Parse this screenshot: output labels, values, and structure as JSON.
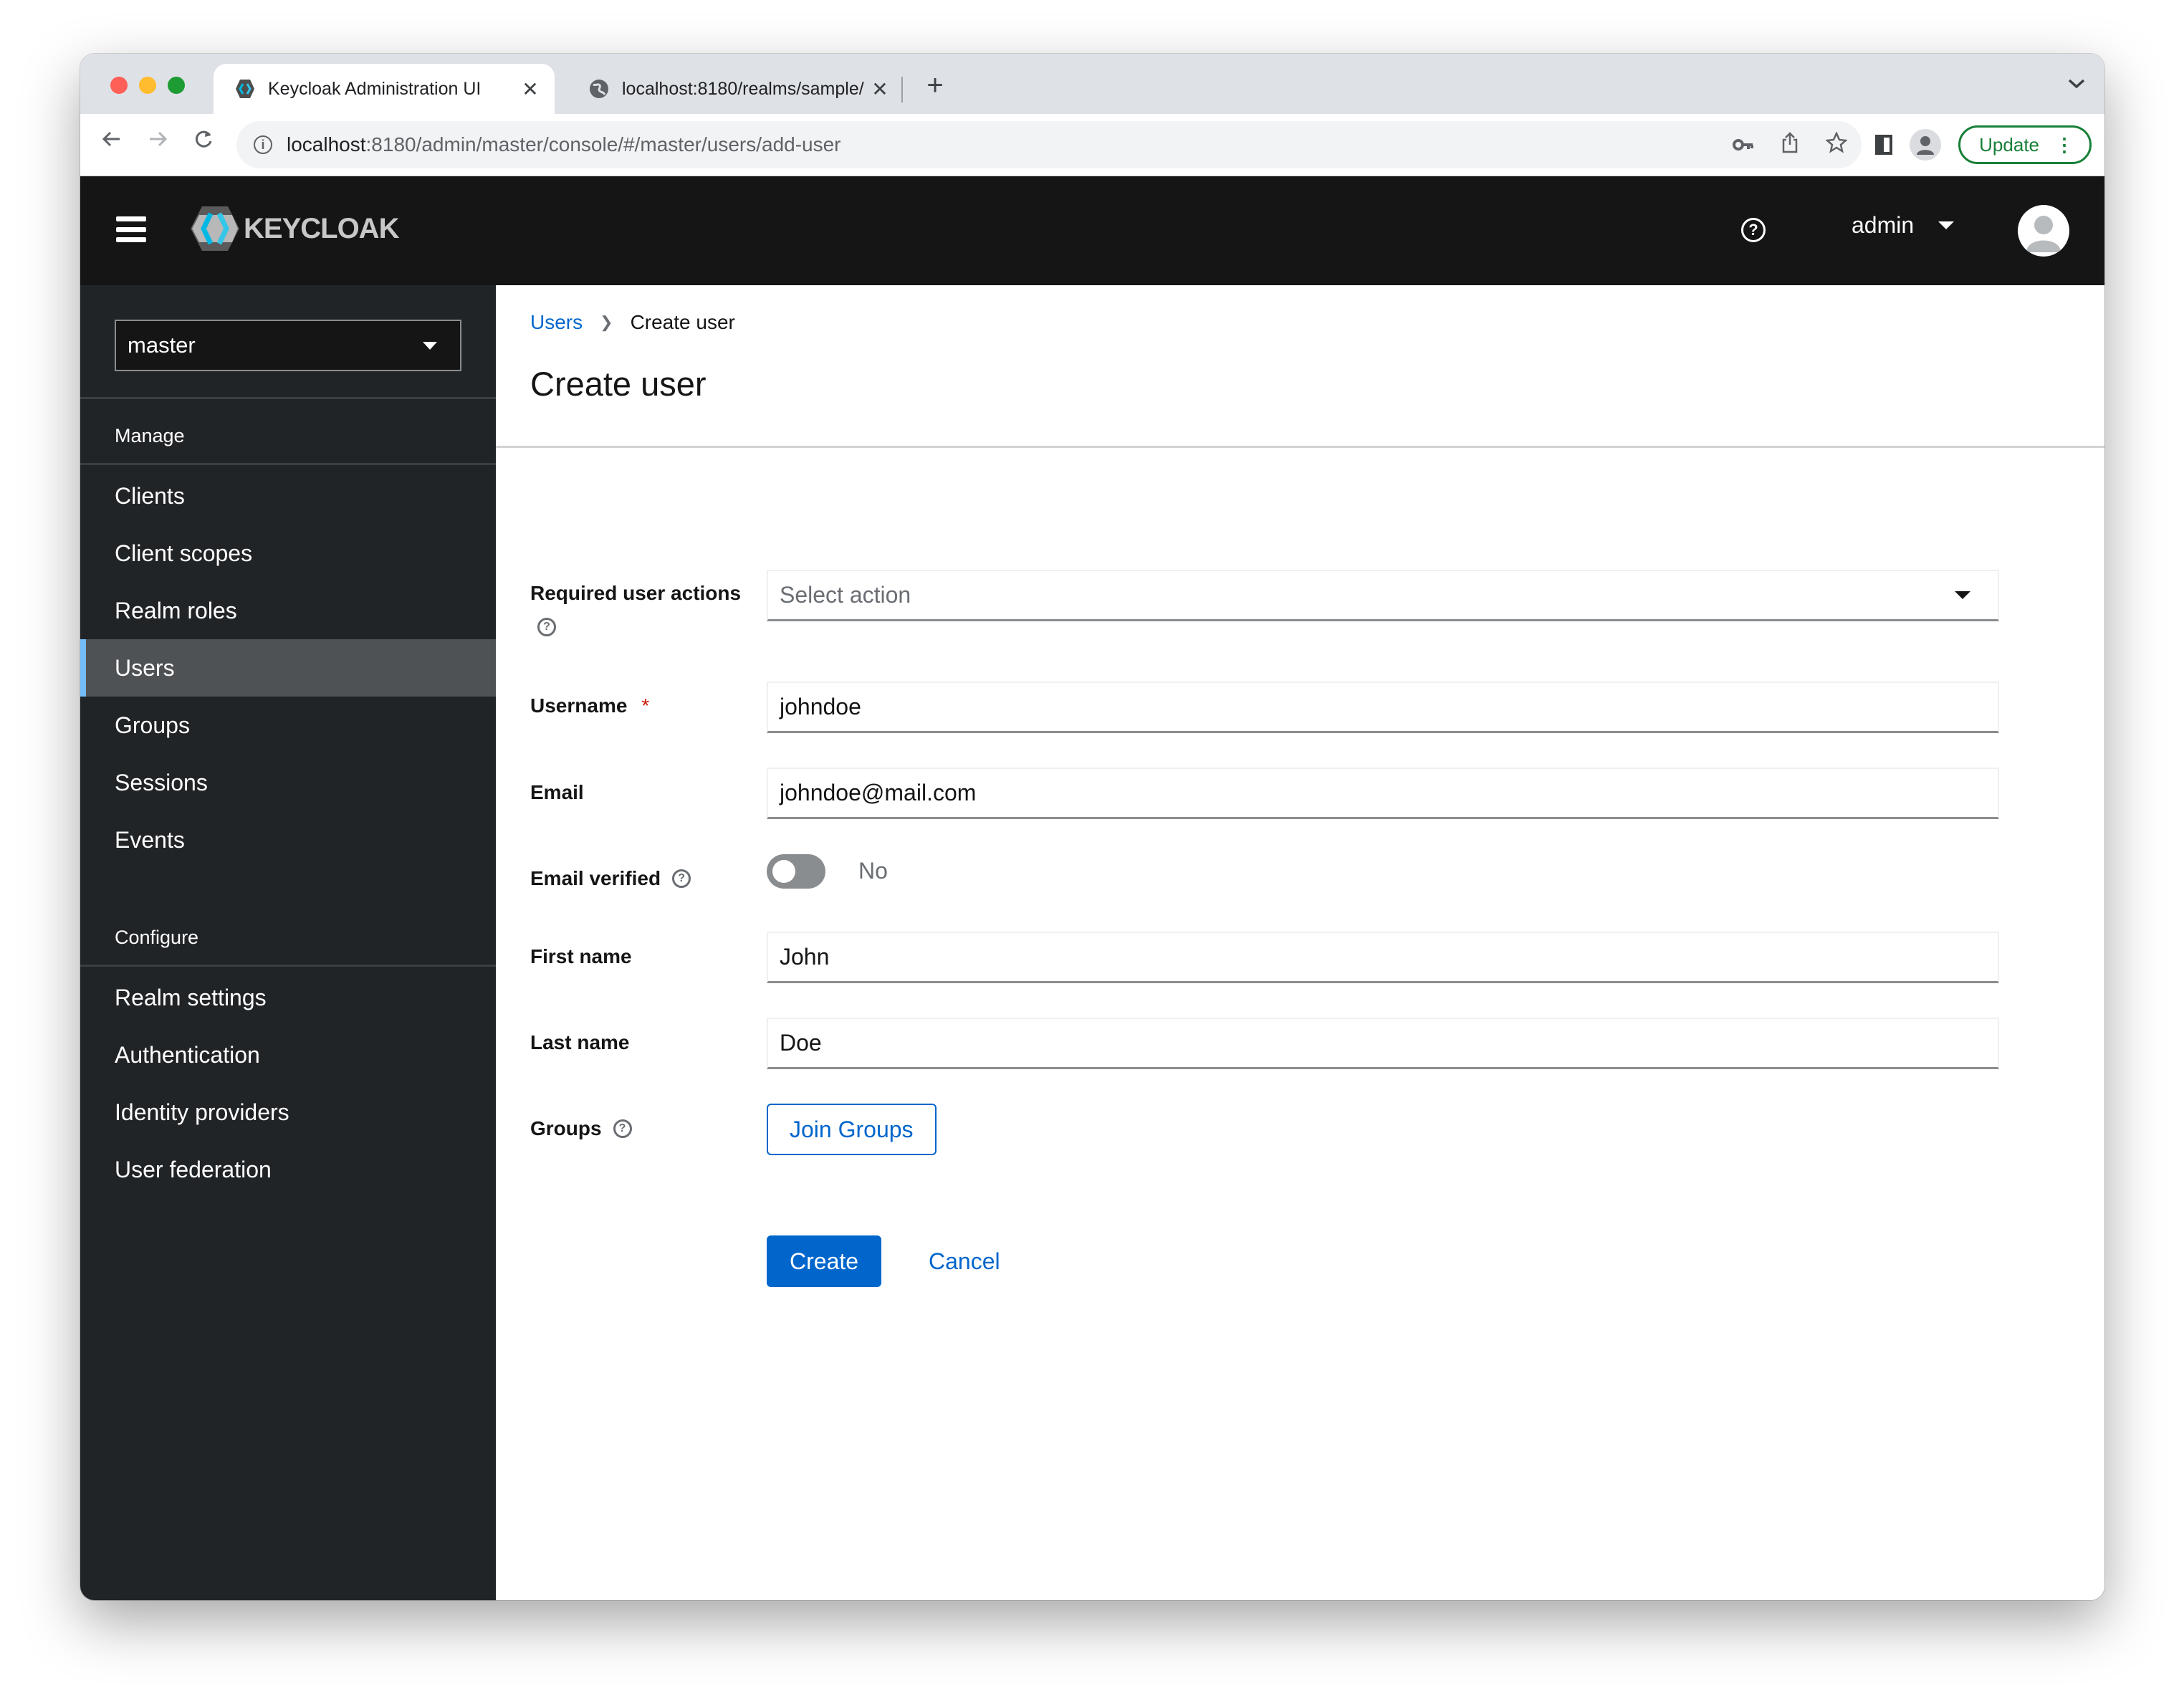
{
  "browser": {
    "tabs": [
      {
        "title": "Keycloak Administration UI",
        "active": true,
        "icon": "keycloak-favicon"
      },
      {
        "title": "localhost:8180/realms/sample/",
        "active": false,
        "icon": "globe-icon"
      }
    ],
    "new_tab_label": "+",
    "address": {
      "host": "localhost",
      "path": ":8180/admin/master/console/#/master/users/add-user"
    },
    "update_label": "Update"
  },
  "header": {
    "logo_text": "KEYCLOAK",
    "user_name": "admin",
    "help_icon": "help-circle-icon"
  },
  "sidebar": {
    "realm": "master",
    "sections": [
      {
        "title": "Manage",
        "items": [
          {
            "label": "Clients",
            "active": false
          },
          {
            "label": "Client scopes",
            "active": false
          },
          {
            "label": "Realm roles",
            "active": false
          },
          {
            "label": "Users",
            "active": true
          },
          {
            "label": "Groups",
            "active": false
          },
          {
            "label": "Sessions",
            "active": false
          },
          {
            "label": "Events",
            "active": false
          }
        ]
      },
      {
        "title": "Configure",
        "items": [
          {
            "label": "Realm settings",
            "active": false
          },
          {
            "label": "Authentication",
            "active": false
          },
          {
            "label": "Identity providers",
            "active": false
          },
          {
            "label": "User federation",
            "active": false
          }
        ]
      }
    ]
  },
  "main": {
    "breadcrumb": [
      {
        "label": "Users",
        "link": true
      },
      {
        "label": "Create user",
        "link": false
      }
    ],
    "title": "Create user",
    "form": {
      "required_actions": {
        "label": "Required user actions",
        "placeholder": "Select action"
      },
      "username": {
        "label": "Username",
        "required_mark": "*",
        "value": "johndoe"
      },
      "email": {
        "label": "Email",
        "value": "johndoe@mail.com"
      },
      "email_verified": {
        "label": "Email verified",
        "state": "No",
        "checked": false
      },
      "first_name": {
        "label": "First name",
        "value": "John"
      },
      "last_name": {
        "label": "Last name",
        "value": "Doe"
      },
      "groups": {
        "label": "Groups",
        "button": "Join Groups"
      }
    },
    "actions": {
      "create": "Create",
      "cancel": "Cancel"
    }
  },
  "colors": {
    "primary": "#0066cc",
    "header_bg": "#151515",
    "sidebar_bg": "#212427",
    "sidebar_active": "#4f5255",
    "active_indicator": "#73bcf7",
    "required": "#c9190b",
    "update_green": "#188038"
  }
}
